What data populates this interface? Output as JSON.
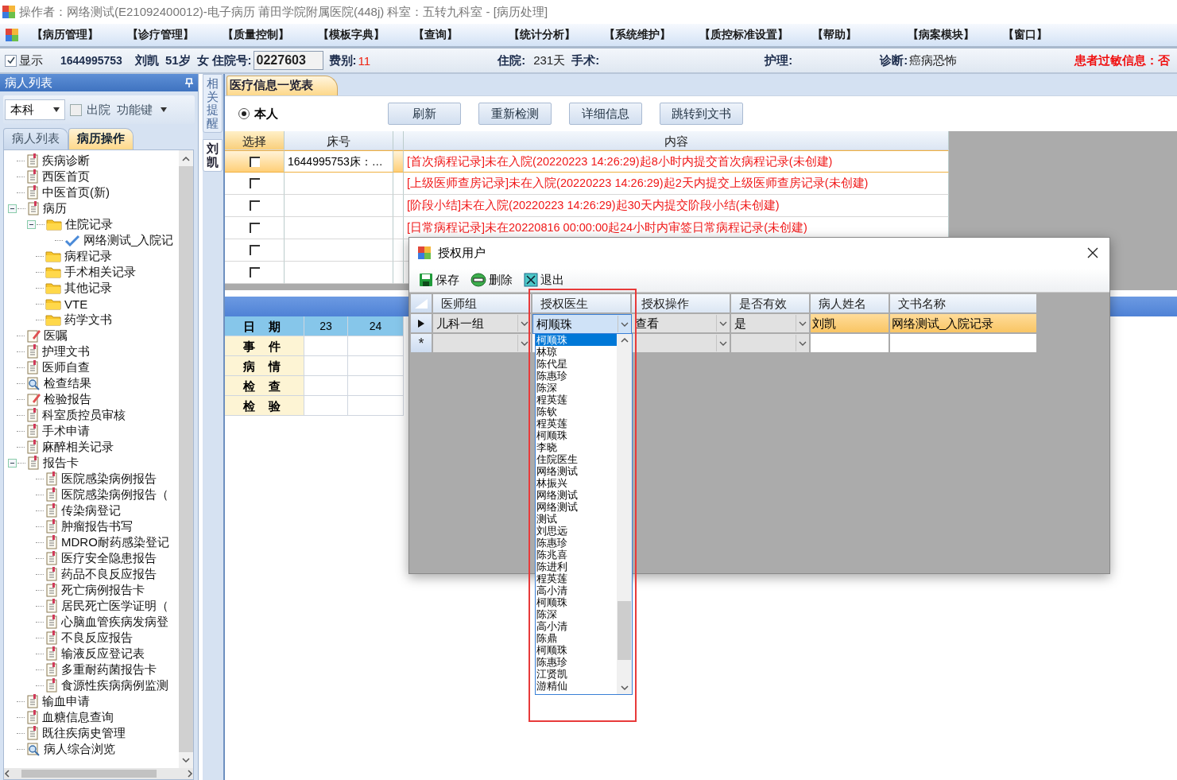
{
  "window": {
    "title": "操作者：网络测试(E21092400012)-电子病历  莆田学院附属医院(448j)  科室：五转九科室 - [病历处理]"
  },
  "menu": [
    "【病历管理】",
    "【诊疗管理】",
    "【质量控制】",
    "【模板字典】",
    "【查询】",
    "【统计分析】",
    "【系统维护】",
    "【质控标准设置】",
    "【帮助】",
    "【病案模块】",
    "【窗口】"
  ],
  "patient_bar": {
    "show": {
      "label": "显示",
      "checked": true
    },
    "id": "1644995753",
    "name": "刘凯",
    "age": "51岁",
    "sex": "女",
    "admission_no_label": "住院号:",
    "admission_no": "0227603",
    "fee_label": "费别:",
    "fee": "11",
    "stay_label": "住院:",
    "stay": "231天",
    "surgery_label": "手术:",
    "nursing_label": "护理:",
    "diagnosis_label": "诊断:",
    "diagnosis": "癌病恐怖",
    "allergy": "患者过敏信息：否"
  },
  "left_panel": {
    "title": "病人列表",
    "scope": "本科",
    "discharged": {
      "label": "出院",
      "checked": false
    },
    "function_key": "功能键",
    "tabs": [
      {
        "label": "病人列表",
        "selected": false
      },
      {
        "label": "病历操作",
        "selected": true
      }
    ],
    "tree": [
      {
        "label": "疾病诊断",
        "kind": "doc"
      },
      {
        "label": "西医首页",
        "kind": "doc"
      },
      {
        "label": "中医首页(新)",
        "kind": "doc"
      },
      {
        "label": "病历",
        "kind": "doc",
        "expanded": true,
        "children": [
          {
            "label": "住院记录",
            "kind": "folder",
            "expanded": true,
            "children": [
              {
                "label": "网络测试_入院记",
                "kind": "check"
              }
            ]
          },
          {
            "label": "病程记录",
            "kind": "folder"
          },
          {
            "label": "手术相关记录",
            "kind": "folder"
          },
          {
            "label": "其他记录",
            "kind": "folder"
          },
          {
            "label": "VTE",
            "kind": "folder"
          },
          {
            "label": "药学文书",
            "kind": "folder"
          }
        ]
      },
      {
        "label": "医嘱",
        "kind": "pencil"
      },
      {
        "label": "护理文书",
        "kind": "doc"
      },
      {
        "label": "医师自查",
        "kind": "doc"
      },
      {
        "label": "检查结果",
        "kind": "lens"
      },
      {
        "label": "检验报告",
        "kind": "pencil"
      },
      {
        "label": "科室质控员审核",
        "kind": "doc"
      },
      {
        "label": "手术申请",
        "kind": "doc"
      },
      {
        "label": "麻醉相关记录",
        "kind": "doc"
      },
      {
        "label": "报告卡",
        "kind": "doc",
        "expanded": true,
        "children": [
          {
            "label": "医院感染病例报告",
            "kind": "doc"
          },
          {
            "label": "医院感染病例报告（",
            "kind": "doc"
          },
          {
            "label": "传染病登记",
            "kind": "doc"
          },
          {
            "label": "肿瘤报告书写",
            "kind": "doc"
          },
          {
            "label": "MDRO耐药感染登记",
            "kind": "doc"
          },
          {
            "label": "医疗安全隐患报告",
            "kind": "doc"
          },
          {
            "label": "药品不良反应报告",
            "kind": "doc"
          },
          {
            "label": "死亡病例报告卡",
            "kind": "doc"
          },
          {
            "label": "居民死亡医学证明（",
            "kind": "doc"
          },
          {
            "label": "心脑血管疾病发病登",
            "kind": "doc"
          },
          {
            "label": "不良反应报告",
            "kind": "doc"
          },
          {
            "label": "输液反应登记表",
            "kind": "doc"
          },
          {
            "label": "多重耐药菌报告卡",
            "kind": "doc"
          },
          {
            "label": "食源性疾病病例监测",
            "kind": "doc"
          }
        ]
      },
      {
        "label": "输血申请",
        "kind": "doc"
      },
      {
        "label": "血糖信息查询",
        "kind": "doc"
      },
      {
        "label": "既往疾病史管理",
        "kind": "doc"
      },
      {
        "label": "病人综合浏览",
        "kind": "lens"
      }
    ]
  },
  "side_tabs": [
    {
      "label": "相关提醒",
      "selected": false
    },
    {
      "label": "刘凯",
      "selected": true
    }
  ],
  "main": {
    "tab": "医疗信息一览表",
    "scope": {
      "label": "本人",
      "selected": true
    },
    "buttons": [
      "刷新",
      "重新检测",
      "详细信息",
      "跳转到文书"
    ],
    "table": {
      "columns": [
        "选择",
        "床号",
        "内容"
      ],
      "rows": [
        {
          "selected": true,
          "checked": false,
          "bed": "1644995753床：…",
          "content": "[首次病程记录]未在入院(20220223 14:26:29)起8小时内提交首次病程记录(未创建)"
        },
        {
          "selected": false,
          "checked": false,
          "content": "[上级医师查房记录]未在入院(20220223 14:26:29)起2天内提交上级医师查房记录(未创建)"
        },
        {
          "selected": false,
          "checked": false,
          "content": "[阶段小结]未在入院(20220223 14:26:29)起30天内提交阶段小结(未创建)"
        },
        {
          "selected": false,
          "checked": false,
          "content": "[日常病程记录]未在20220816 00:00:00起24小时内审签日常病程记录(未创建)"
        },
        {
          "selected": false,
          "checked": false
        },
        {
          "selected": false,
          "checked": false
        }
      ]
    },
    "calendar": {
      "date_label": "日 期",
      "dates": [
        "23",
        "24"
      ],
      "rows": [
        "事 件",
        "病 情",
        "检 查",
        "检 验"
      ]
    }
  },
  "dialog": {
    "title": "授权用户",
    "toolbar": [
      "保存",
      "删除",
      "退出"
    ],
    "columns": [
      "医师组",
      "授权医生",
      "授权操作",
      "是否有效",
      "病人姓名",
      "文书名称"
    ],
    "rows": [
      {
        "current": true,
        "group": "儿科一组",
        "doctor": "柯顺珠",
        "operation": "查看",
        "valid": "是",
        "patient": "刘凯",
        "document": "网络测试_入院记录"
      }
    ],
    "new_row_marker": "*",
    "dropdown": [
      {
        "label": "柯顺珠",
        "selected": true
      },
      {
        "label": "林琼",
        "selected": false
      },
      {
        "label": "陈代星",
        "selected": false
      },
      {
        "label": "陈惠珍",
        "selected": false
      },
      {
        "label": "陈深",
        "selected": false
      },
      {
        "label": "程英莲",
        "selected": false
      },
      {
        "label": "陈钦",
        "selected": false
      },
      {
        "label": "程英莲",
        "selected": false
      },
      {
        "label": "柯顺珠",
        "selected": false
      },
      {
        "label": "李晓",
        "selected": false
      },
      {
        "label": "住院医生",
        "selected": false
      },
      {
        "label": "网络测试",
        "selected": false
      },
      {
        "label": "林振兴",
        "selected": false
      },
      {
        "label": "网络测试",
        "selected": false
      },
      {
        "label": "网络测试",
        "selected": false
      },
      {
        "label": "测试",
        "selected": false
      },
      {
        "label": "刘思远",
        "selected": false
      },
      {
        "label": "陈惠珍",
        "selected": false
      },
      {
        "label": "陈兆喜",
        "selected": false
      },
      {
        "label": "陈进利",
        "selected": false
      },
      {
        "label": "程英莲",
        "selected": false
      },
      {
        "label": "高小清",
        "selected": false
      },
      {
        "label": "柯顺珠",
        "selected": false
      },
      {
        "label": "陈深",
        "selected": false
      },
      {
        "label": "高小清",
        "selected": false
      },
      {
        "label": "陈鼎",
        "selected": false
      },
      {
        "label": "柯顺珠",
        "selected": false
      },
      {
        "label": "陈惠珍",
        "selected": false
      },
      {
        "label": "江贤凯",
        "selected": false
      },
      {
        "label": "游精仙",
        "selected": false
      }
    ]
  },
  "annotation": {
    "kind": "rectangle"
  }
}
